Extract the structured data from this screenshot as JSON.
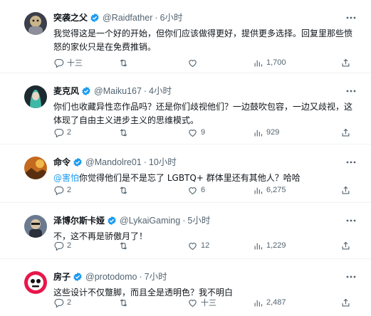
{
  "tweets": [
    {
      "name": "突袭之父",
      "handle": "@Raidfather",
      "time": "6小时",
      "text": "我觉得这是一个好的开始，但你们应该做得更好，提供更多选择。回复里那些愤怒的家伙只是在免费推销。",
      "replies": "十三",
      "retweets": "",
      "likes": "",
      "views": "1,700",
      "avatar_colors": [
        "#3a3f4a",
        "#c9b48c"
      ]
    },
    {
      "name": "麦克风",
      "handle": "@Maiku167",
      "time": "4小时",
      "text": "你们也收藏异性恋作品吗？还是你们歧视他们？一边鼓吹包容，一边又歧视，这体现了自由主义进步主义的思维模式。",
      "replies": "2",
      "retweets": "",
      "likes": "9",
      "views": "929",
      "avatar_colors": [
        "#1d2a2f",
        "#3fb8a8"
      ]
    },
    {
      "name": "命令",
      "handle": "@Mandolre01",
      "time": "10小时",
      "mention": "@害怕",
      "text": "你觉得他们是不是忘了 LGBTQ+ 群体里还有其他人？哈哈",
      "replies": "2",
      "retweets": "",
      "likes": "6",
      "views": "6,275",
      "avatar_colors": [
        "#c46a1e",
        "#f2b84a"
      ]
    },
    {
      "name": "泽博尔斯卡娅",
      "handle": "@LykaiGaming",
      "time": "5小时",
      "text": "不，这不再是骄傲月了！",
      "replies": "2",
      "retweets": "",
      "likes": "12",
      "views": "1,229",
      "avatar_colors": [
        "#6b7a8f",
        "#d6c3a5"
      ]
    },
    {
      "name": "房子",
      "handle": "@protodomo",
      "time": "7小时",
      "text": "这些设计不仅蹩脚，而且全是透明色？我不明白",
      "replies": "2",
      "retweets": "",
      "likes": "十三",
      "views": "2,487",
      "avatar_colors": [
        "#e8174a",
        "#ffffff"
      ]
    }
  ],
  "colors": {
    "verified": "#1d9bf0",
    "secondary_text": "#536471",
    "link": "#1d9bf0"
  },
  "icons": [
    "reply-icon",
    "retweet-icon",
    "like-icon",
    "views-icon",
    "share-icon",
    "more-icon",
    "verified-badge-icon"
  ]
}
